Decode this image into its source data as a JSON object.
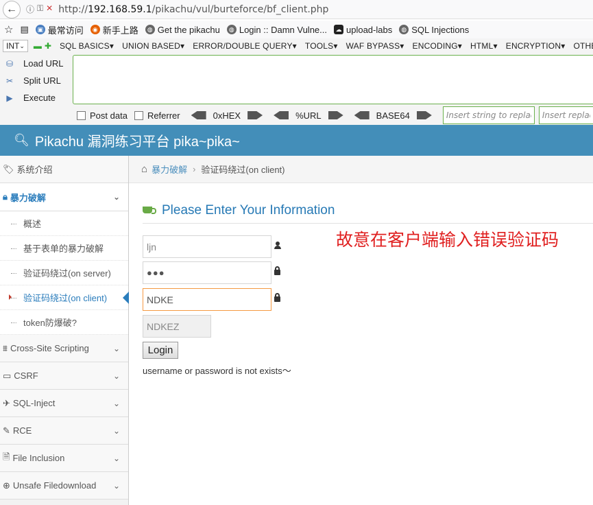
{
  "browser": {
    "url_prefix": "http://",
    "url_host": "192.168.59.1",
    "url_path": "/pikachu/vul/burteforce/bf_client.php",
    "bookmarks": [
      "最常访问",
      "新手上路",
      "Get the pikachu",
      "Login :: Damn Vulne...",
      "upload-labs",
      "SQL Injections"
    ]
  },
  "hackbar": {
    "select_value": "INT",
    "menu": [
      "SQL BASICS",
      "UNION BASED",
      "ERROR/DOUBLE QUERY",
      "TOOLS",
      "WAF BYPASS",
      "ENCODING",
      "HTML",
      "ENCRYPTION",
      "OTHER"
    ],
    "actions": [
      "Load URL",
      "Split URL",
      "Execute"
    ],
    "post_data": "Post data",
    "referrer": "Referrer",
    "enc": [
      "0xHEX",
      "%URL",
      "BASE64"
    ],
    "replace_placeholder_1": "Insert string to replace",
    "replace_placeholder_2": "Insert replacing string"
  },
  "site": {
    "title": "Pikachu 漏洞练习平台 pika~pika~"
  },
  "sidebar": {
    "items": [
      {
        "label": "系统介绍"
      },
      {
        "label": "暴力破解"
      },
      {
        "label": "Cross-Site Scripting"
      },
      {
        "label": "CSRF"
      },
      {
        "label": "SQL-Inject"
      },
      {
        "label": "RCE"
      },
      {
        "label": "File Inclusion"
      },
      {
        "label": "Unsafe Filedownload"
      }
    ],
    "sub_items": [
      "概述",
      "基于表单的暴力破解",
      "验证码绕过(on server)",
      "验证码绕过(on client)",
      "token防爆破?"
    ]
  },
  "breadcrumb": {
    "parent": "暴力破解",
    "current": "验证码绕过(on client)"
  },
  "form": {
    "heading": "Please Enter Your Information",
    "username_value": "ljn",
    "password_mask": "●●●",
    "captcha_input_value": "NDKE",
    "captcha_code": "NDKEZ",
    "login_label": "Login",
    "result_text": "username or password is not exists～"
  },
  "annotation": "故意在客户端输入错误验证码"
}
